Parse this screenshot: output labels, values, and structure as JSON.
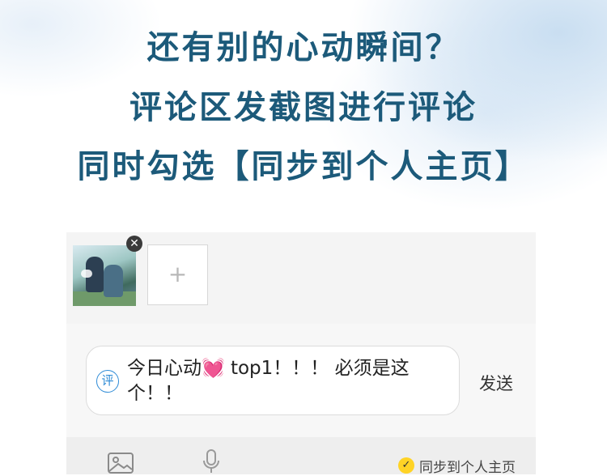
{
  "headlines": {
    "line1": "还有别的心动瞬间？",
    "line2": "评论区发截图进行评论",
    "line3_prefix": "同时勾选",
    "line3_highlight": "【同步到个人主页】"
  },
  "composer": {
    "attachments": {
      "remove_icon": "close-icon",
      "add_symbol": "+"
    },
    "ping_icon_label": "评",
    "comment_text": "今日心动💓 top1！！！ 必须是这个！！",
    "send_label": "发送",
    "toolbar": {
      "image_icon": "image-icon",
      "mic_icon": "microphone-icon",
      "sync_label": "同步到个人主页",
      "sync_checked": true
    }
  },
  "colors": {
    "headline": "#1c5a7a",
    "highlight": "#fbf4bf",
    "accent_blue": "#2e8bd6",
    "check_yellow": "#ffd325"
  }
}
